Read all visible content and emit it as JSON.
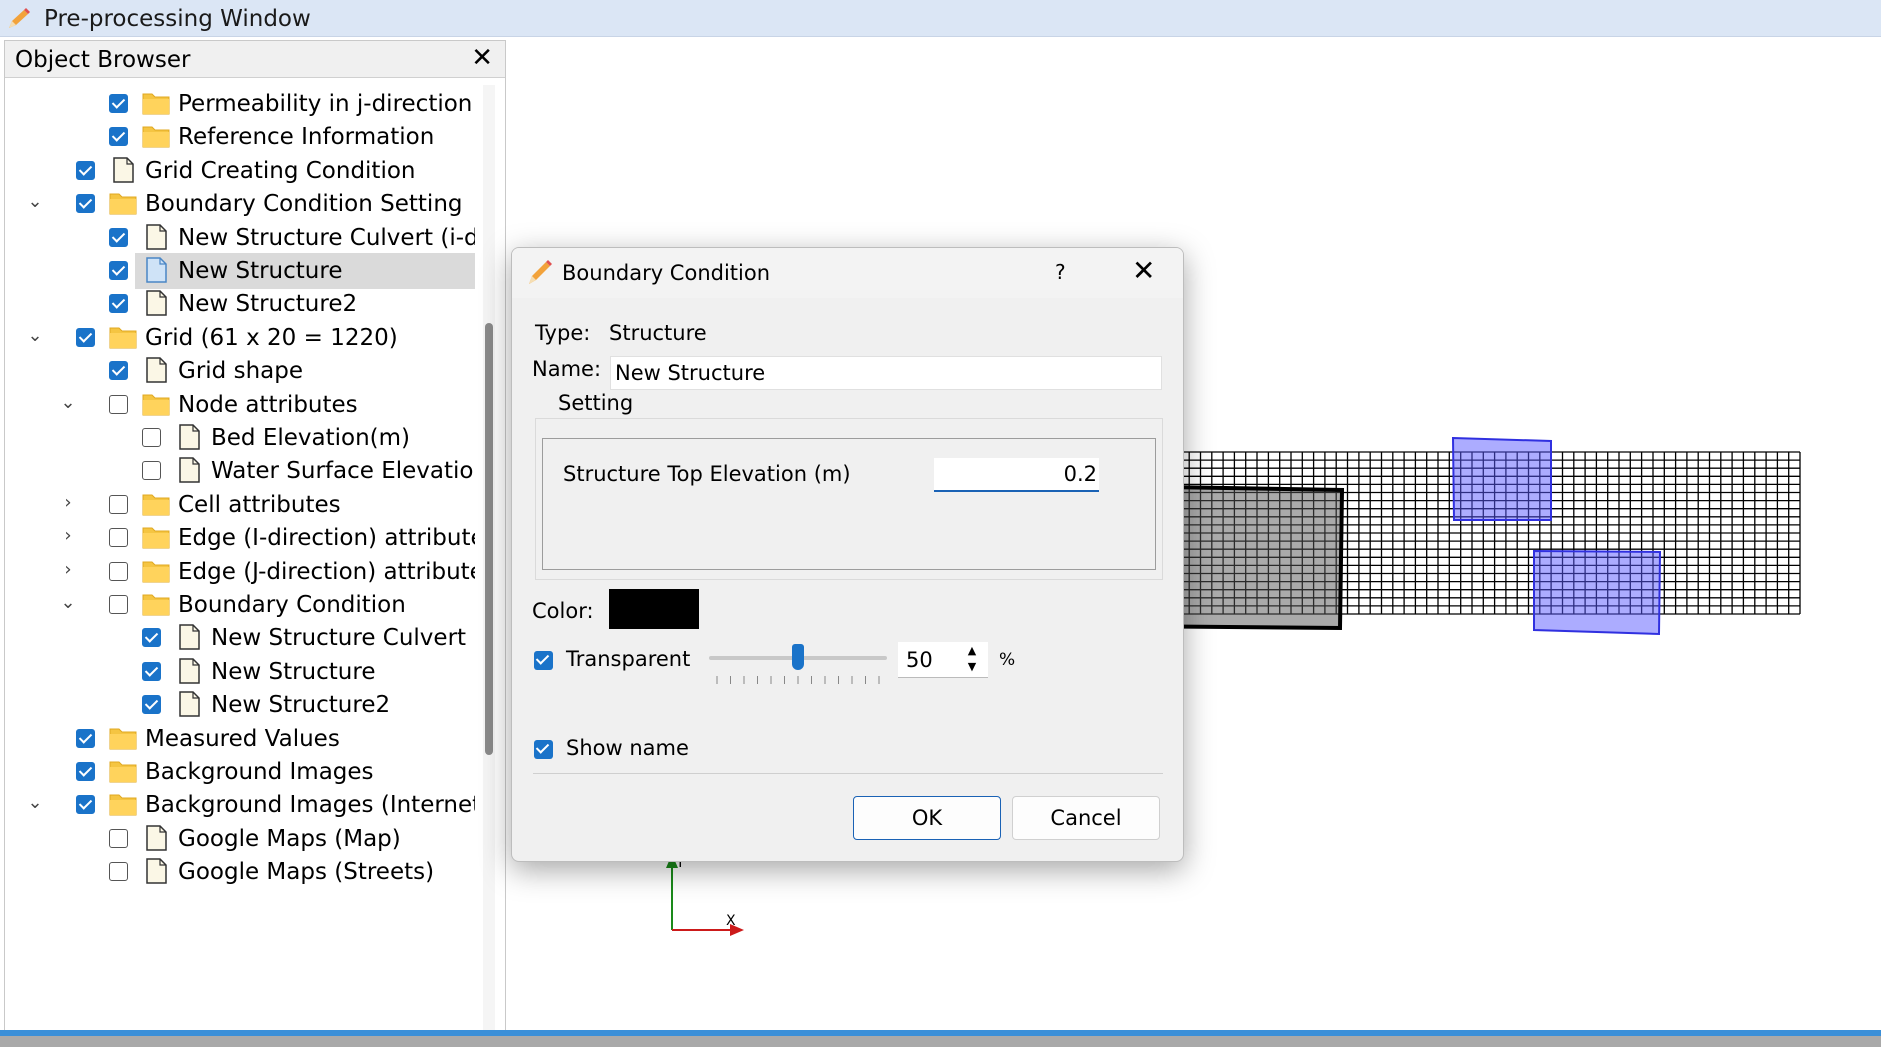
{
  "window": {
    "title": "Pre-processing Window"
  },
  "object_browser": {
    "title": "Object Browser",
    "close": "✕",
    "items": [
      {
        "label": "Permeability in j-direction",
        "level": 2,
        "expander": "",
        "checked": true,
        "icon": "folder-icon"
      },
      {
        "label": "Reference Information",
        "level": 2,
        "expander": "",
        "checked": true,
        "icon": "folder-icon"
      },
      {
        "label": "Grid Creating Condition",
        "level": 1,
        "expander": "",
        "checked": true,
        "icon": "document-icon"
      },
      {
        "label": "Boundary Condition Setting",
        "level": 1,
        "expander": "⌄",
        "checked": true,
        "icon": "folder-icon"
      },
      {
        "label": "New Structure Culvert (i-d...",
        "level": 2,
        "expander": "",
        "checked": true,
        "icon": "document-icon"
      },
      {
        "label": "New Structure",
        "level": 2,
        "expander": "",
        "checked": true,
        "icon": "document-icon-selected",
        "selected": true
      },
      {
        "label": "New Structure2",
        "level": 2,
        "expander": "",
        "checked": true,
        "icon": "document-icon"
      },
      {
        "label": "Grid (61 x 20 = 1220)",
        "level": 1,
        "expander": "⌄",
        "checked": true,
        "icon": "folder-icon"
      },
      {
        "label": "Grid shape",
        "level": 2,
        "expander": "",
        "checked": true,
        "icon": "document-icon"
      },
      {
        "label": "Node attributes",
        "level": 2,
        "expander": "⌄",
        "checked": false,
        "icon": "folder-icon"
      },
      {
        "label": "Bed Elevation(m)",
        "level": 3,
        "expander": "",
        "checked": false,
        "icon": "document-icon"
      },
      {
        "label": "Water Surface Elevatio...",
        "level": 3,
        "expander": "",
        "checked": false,
        "icon": "document-icon"
      },
      {
        "label": "Cell attributes",
        "level": 2,
        "expander": "›",
        "checked": false,
        "icon": "folder-icon"
      },
      {
        "label": "Edge (I-direction) attributes",
        "level": 2,
        "expander": "›",
        "checked": false,
        "icon": "folder-icon"
      },
      {
        "label": "Edge (J-direction) attributes",
        "level": 2,
        "expander": "›",
        "checked": false,
        "icon": "folder-icon"
      },
      {
        "label": "Boundary Condition",
        "level": 2,
        "expander": "⌄",
        "checked": false,
        "icon": "folder-icon"
      },
      {
        "label": "New Structure Culvert ...",
        "level": 3,
        "expander": "",
        "checked": true,
        "icon": "document-icon"
      },
      {
        "label": "New Structure",
        "level": 3,
        "expander": "",
        "checked": true,
        "icon": "document-icon"
      },
      {
        "label": "New Structure2",
        "level": 3,
        "expander": "",
        "checked": true,
        "icon": "document-icon"
      },
      {
        "label": "Measured Values",
        "level": 1,
        "expander": "",
        "checked": true,
        "icon": "folder-icon"
      },
      {
        "label": "Background Images",
        "level": 1,
        "expander": "",
        "checked": true,
        "icon": "folder-icon"
      },
      {
        "label": "Background Images (Internet)",
        "level": 1,
        "expander": "⌄",
        "checked": true,
        "icon": "folder-icon"
      },
      {
        "label": "Google Maps (Map)",
        "level": 2,
        "expander": "",
        "checked": false,
        "icon": "document-icon"
      },
      {
        "label": "Google Maps (Streets)",
        "level": 2,
        "expander": "",
        "checked": false,
        "icon": "document-icon"
      }
    ]
  },
  "canvas": {
    "axis_y": "Y",
    "axis_x": "X",
    "colors": {
      "grid": "#000000",
      "structure_blue": "#5a5aff",
      "structure_dark": "#555555",
      "axis_y": "#1a8a1a",
      "axis_x": "#cc1a1a"
    }
  },
  "dialog": {
    "title": "Boundary Condition",
    "help": "?",
    "close": "✕",
    "type_label": "Type:",
    "type_value": "Structure",
    "name_label": "Name:",
    "name_value": "New Structure",
    "setting_label": "Setting",
    "elevation_label": "Structure Top Elevation (m)",
    "elevation_value": "0.2",
    "color_label": "Color:",
    "color_value": "#000000",
    "transparent_label": "Transparent",
    "transparent_checked": true,
    "transparency_value": "50",
    "transparency_fraction": 0.5,
    "percent": "%",
    "show_name_label": "Show name",
    "show_name_checked": true,
    "ok": "OK",
    "cancel": "Cancel"
  }
}
